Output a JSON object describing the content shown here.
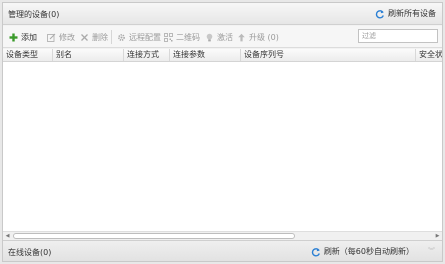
{
  "managed_panel": {
    "title": "管理的设备(0)",
    "refresh_all_label": "刷新所有设备"
  },
  "toolbar": {
    "add_label": "添加",
    "modify_label": "修改",
    "delete_label": "删除",
    "remote_config_label": "远程配置",
    "qrcode_label": "二维码",
    "activate_label": "激活",
    "upgrade_label": "升级 (0)",
    "filter_placeholder": "过滤"
  },
  "columns": [
    "设备类型",
    "别名",
    "连接方式",
    "连接参数",
    "设备序列号",
    "安全状"
  ],
  "online_panel": {
    "title": "在线设备(0)",
    "refresh_label": "刷新（每60秒自动刷新）"
  },
  "colors": {
    "accent_green": "#3a9a2a",
    "refresh_blue": "#2a7fd4",
    "disabled_gray": "#9a9a9a"
  }
}
